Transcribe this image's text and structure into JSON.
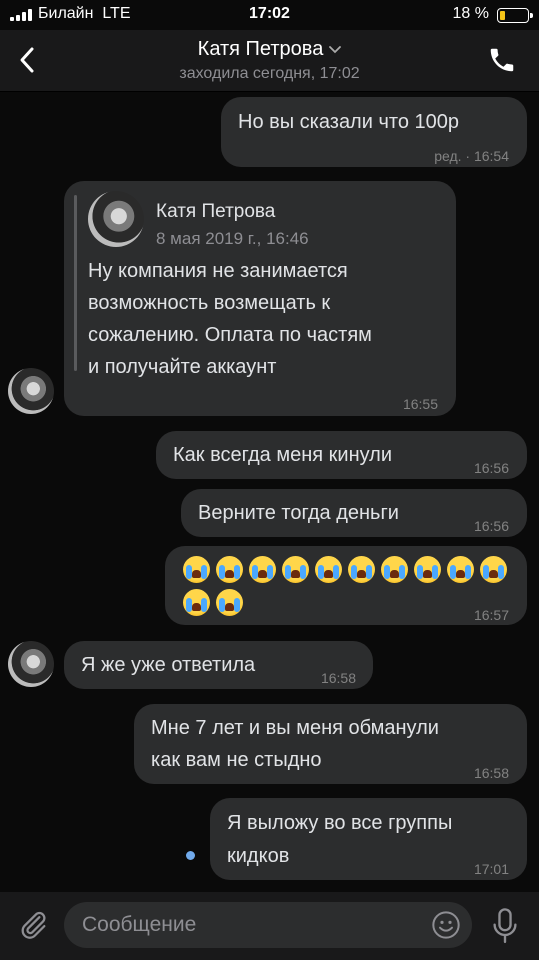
{
  "status_bar": {
    "carrier": "Билайн",
    "network": "LTE",
    "time": "17:02",
    "battery_percent": "18 %",
    "battery_level": 0.18,
    "battery_color": "#f5c518"
  },
  "header": {
    "back_icon": "chevron-left-icon",
    "title": "Катя Петрова",
    "title_icon": "chevron-down-icon",
    "subtitle": "заходила сегодня, 17:02",
    "call_icon": "phone-icon"
  },
  "messages": [
    {
      "direction": "out",
      "text": "Но вы сказали что 100р",
      "meta": "ред. · 16:54"
    },
    {
      "direction": "in",
      "forwarded": {
        "author": "Катя Петрова",
        "date": "8 мая 2019 г., 16:46",
        "lines": [
          "Ну компания не занимается",
          "возможность возмещать к",
          "сожалению. Оплата по частям",
          "и получайте аккаунт"
        ]
      },
      "time": "16:55"
    },
    {
      "direction": "out",
      "text": "Как всегда меня кинули",
      "time": "16:56"
    },
    {
      "direction": "out",
      "text": "Верните тогда деньги",
      "time": "16:56"
    },
    {
      "direction": "out",
      "emoji": "loudly-crying-face",
      "emoji_count": 12,
      "time": "16:57"
    },
    {
      "direction": "in",
      "text": "Я же уже ответила",
      "time": "16:58"
    },
    {
      "direction": "out",
      "lines": [
        "Мне 7 лет и вы меня обманули",
        "как вам не стыдно"
      ],
      "time": "16:58"
    },
    {
      "direction": "out",
      "lines": [
        "Я выложу во все группы",
        "кидков"
      ],
      "time": "17:01",
      "unread": true
    }
  ],
  "input": {
    "placeholder": "Сообщение",
    "attach_icon": "paperclip-icon",
    "emoji_icon": "smile-icon",
    "mic_icon": "microphone-icon"
  },
  "colors": {
    "background": "#0a0a0a",
    "bar": "#19191a",
    "bubble": "#2c2d2e",
    "accent": "#71aaeb"
  }
}
